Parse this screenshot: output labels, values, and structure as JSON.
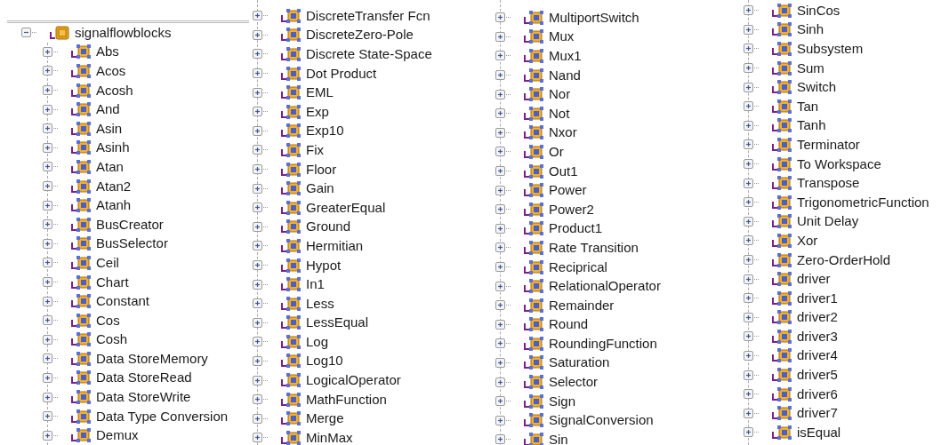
{
  "tree": {
    "label": "signalflowblocks",
    "expanded": true,
    "children": [
      {
        "label": "Abs",
        "expanded": false
      },
      {
        "label": "Acos",
        "expanded": false
      },
      {
        "label": "Acosh",
        "expanded": false
      },
      {
        "label": "And",
        "expanded": false
      },
      {
        "label": "Asin",
        "expanded": false
      },
      {
        "label": "Asinh",
        "expanded": false
      },
      {
        "label": "Atan",
        "expanded": false
      },
      {
        "label": "Atan2",
        "expanded": false
      },
      {
        "label": "Atanh",
        "expanded": false
      },
      {
        "label": "BusCreator",
        "expanded": false
      },
      {
        "label": "BusSelector",
        "expanded": false
      },
      {
        "label": "Ceil",
        "expanded": false
      },
      {
        "label": "Chart",
        "expanded": false
      },
      {
        "label": "Constant",
        "expanded": false
      },
      {
        "label": "Cos",
        "expanded": false
      },
      {
        "label": "Cosh",
        "expanded": false
      },
      {
        "label": "Data StoreMemory",
        "expanded": false
      },
      {
        "label": "Data StoreRead",
        "expanded": false
      },
      {
        "label": "Data StoreWrite",
        "expanded": false
      },
      {
        "label": "Data Type Conversion",
        "expanded": false
      },
      {
        "label": "Demux",
        "expanded": false
      },
      {
        "label": "DiscreteTransfer Fcn",
        "expanded": false
      },
      {
        "label": "DiscreteZero-Pole",
        "expanded": false
      },
      {
        "label": "Discrete State-Space",
        "expanded": false
      },
      {
        "label": "Dot Product",
        "expanded": false
      },
      {
        "label": "EML",
        "expanded": false
      },
      {
        "label": "Exp",
        "expanded": false
      },
      {
        "label": "Exp10",
        "expanded": false
      },
      {
        "label": "Fix",
        "expanded": false
      },
      {
        "label": "Floor",
        "expanded": false
      },
      {
        "label": "Gain",
        "expanded": false
      },
      {
        "label": "GreaterEqual",
        "expanded": false
      },
      {
        "label": "Ground",
        "expanded": false
      },
      {
        "label": "Hermitian",
        "expanded": false
      },
      {
        "label": "Hypot",
        "expanded": false
      },
      {
        "label": "In1",
        "expanded": false
      },
      {
        "label": "Less",
        "expanded": false
      },
      {
        "label": "LessEqual",
        "expanded": false
      },
      {
        "label": "Log",
        "expanded": false
      },
      {
        "label": "Log10",
        "expanded": false
      },
      {
        "label": "LogicalOperator",
        "expanded": false
      },
      {
        "label": "MathFunction",
        "expanded": false
      },
      {
        "label": "Merge",
        "expanded": false
      },
      {
        "label": "MinMax",
        "expanded": false
      },
      {
        "label": "MultiportSwitch",
        "expanded": false
      },
      {
        "label": "Mux",
        "expanded": false
      },
      {
        "label": "Mux1",
        "expanded": false
      },
      {
        "label": "Nand",
        "expanded": false
      },
      {
        "label": "Nor",
        "expanded": false
      },
      {
        "label": "Not",
        "expanded": false
      },
      {
        "label": "Nxor",
        "expanded": false
      },
      {
        "label": "Or",
        "expanded": false
      },
      {
        "label": "Out1",
        "expanded": false
      },
      {
        "label": "Power",
        "expanded": false
      },
      {
        "label": "Power2",
        "expanded": false
      },
      {
        "label": "Product1",
        "expanded": false
      },
      {
        "label": "Rate Transition",
        "expanded": false
      },
      {
        "label": "Reciprical",
        "expanded": false
      },
      {
        "label": "RelationalOperator",
        "expanded": false
      },
      {
        "label": "Remainder",
        "expanded": false
      },
      {
        "label": "Round",
        "expanded": false
      },
      {
        "label": "RoundingFunction",
        "expanded": false
      },
      {
        "label": "Saturation",
        "expanded": false
      },
      {
        "label": "Selector",
        "expanded": false
      },
      {
        "label": "Sign",
        "expanded": false
      },
      {
        "label": "SignalConversion",
        "expanded": false
      },
      {
        "label": "Sin",
        "expanded": false
      },
      {
        "label": "SinCos",
        "expanded": false
      },
      {
        "label": "Sinh",
        "expanded": false
      },
      {
        "label": "Subsystem",
        "expanded": false
      },
      {
        "label": "Sum",
        "expanded": false
      },
      {
        "label": "Switch",
        "expanded": false
      },
      {
        "label": "Tan",
        "expanded": false
      },
      {
        "label": "Tanh",
        "expanded": false
      },
      {
        "label": "Terminator",
        "expanded": false
      },
      {
        "label": "To Workspace",
        "expanded": false
      },
      {
        "label": "Transpose",
        "expanded": false
      },
      {
        "label": "TrigonometricFunction",
        "expanded": false
      },
      {
        "label": "Unit Delay",
        "expanded": false
      },
      {
        "label": "Xor",
        "expanded": false
      },
      {
        "label": "Zero-OrderHold",
        "expanded": false
      },
      {
        "label": "driver",
        "expanded": false
      },
      {
        "label": "driver1",
        "expanded": false
      },
      {
        "label": "driver2",
        "expanded": false
      },
      {
        "label": "driver3",
        "expanded": false
      },
      {
        "label": "driver4",
        "expanded": false
      },
      {
        "label": "driver5",
        "expanded": false
      },
      {
        "label": "driver6",
        "expanded": false
      },
      {
        "label": "driver7",
        "expanded": false
      },
      {
        "label": "isEqual",
        "expanded": false
      }
    ]
  }
}
